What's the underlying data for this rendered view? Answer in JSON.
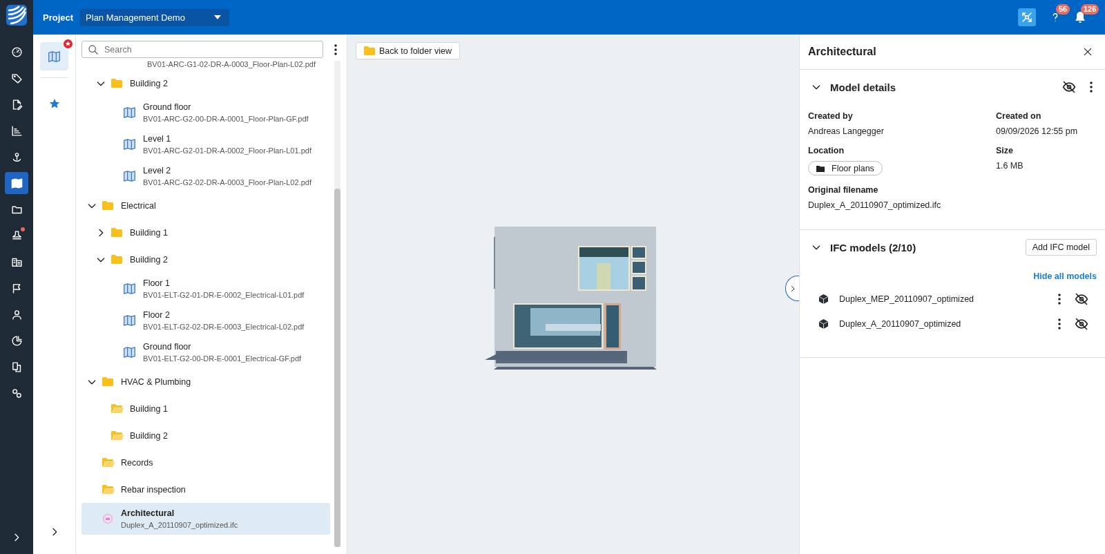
{
  "top_bar": {
    "project_label": "Project",
    "project_select": "Plan Management Demo",
    "help_badge": "56",
    "notifications_badge": "126"
  },
  "nav_rail": {
    "items": [
      {
        "selected": false,
        "dot": false
      },
      {
        "selected": false,
        "dot": false
      },
      {
        "selected": false,
        "dot": false
      },
      {
        "selected": false,
        "dot": false
      },
      {
        "selected": false,
        "dot": false
      },
      {
        "selected": true,
        "dot": false
      },
      {
        "selected": false,
        "dot": false
      },
      {
        "selected": false,
        "dot": true
      },
      {
        "selected": false,
        "dot": false
      },
      {
        "selected": false,
        "dot": false
      },
      {
        "selected": false,
        "dot": false
      },
      {
        "selected": false,
        "dot": false
      },
      {
        "selected": false,
        "dot": false
      },
      {
        "selected": false,
        "dot": false
      }
    ]
  },
  "side_rail": {
    "items": [
      {
        "selected": true,
        "badge": true
      },
      {
        "selected": false,
        "badge": false
      }
    ]
  },
  "tree": {
    "search": {
      "placeholder": "Search"
    },
    "cut_filename": "BV01-ARC-G1-02-DR-A-0003_Floor-Plan-L02.pdf",
    "continued": [
      {
        "kind": "folder",
        "label": "Building 2",
        "expanded": true,
        "selected": false,
        "children": [
          {
            "kind": "plan",
            "label": "Ground floor",
            "filename": "BV01-ARC-G2-00-DR-A-0001_Floor-Plan-GF.pdf",
            "selected": false
          },
          {
            "kind": "plan",
            "label": "Level 1",
            "filename": "BV01-ARC-G2-01-DR-A-0002_Floor-Plan-L01.pdf",
            "selected": false
          },
          {
            "kind": "plan",
            "label": "Level 2",
            "filename": "BV01-ARC-G2-02-DR-A-0003_Floor-Plan-L02.pdf",
            "selected": false
          }
        ]
      }
    ],
    "items": [
      {
        "kind": "folder",
        "label": "Electrical",
        "expanded": true,
        "selected": false,
        "children": [
          {
            "kind": "folder",
            "label": "Building 1",
            "expanded": false,
            "selected": false
          },
          {
            "kind": "folder",
            "label": "Building 2",
            "expanded": true,
            "selected": false,
            "children": [
              {
                "kind": "plan",
                "label": "Floor 1",
                "filename": "BV01-ELT-G2-01-DR-E-0002_Electrical-L01.pdf",
                "selected": false
              },
              {
                "kind": "plan",
                "label": "Floor 2",
                "filename": "BV01-ELT-G2-02-DR-E-0003_Electrical-L02.pdf",
                "selected": false
              },
              {
                "kind": "plan",
                "label": "Ground floor",
                "filename": "BV01-ELT-G2-00-DR-E-0001_Electrical-GF.pdf",
                "selected": false
              }
            ]
          }
        ]
      },
      {
        "kind": "folder",
        "label": "HVAC & Plumbing",
        "expanded": true,
        "selected": false,
        "children": [
          {
            "kind": "empty_folder",
            "label": "Building 1",
            "selected": false
          },
          {
            "kind": "empty_folder",
            "label": "Building 2",
            "selected": false
          }
        ]
      },
      {
        "kind": "empty_folder",
        "label": "Records",
        "selected": false
      },
      {
        "kind": "empty_folder",
        "label": "Rebar inspection",
        "selected": false
      },
      {
        "kind": "model",
        "label": "Architectural",
        "filename": "Duplex_A_20110907_optimized.ifc",
        "selected": true
      }
    ]
  },
  "viewer": {
    "back_button": "Back to folder view"
  },
  "details": {
    "title": "Architectural",
    "model_details": {
      "heading": "Model details",
      "expanded": true,
      "visible": false,
      "fields": [
        {
          "kind": "text",
          "label": "Created by",
          "value": "Andreas Langegger"
        },
        {
          "kind": "text",
          "label": "Created on",
          "value": "09/09/2026 12:55 pm"
        },
        {
          "kind": "chip",
          "label": "Location",
          "value": "Floor plans"
        },
        {
          "kind": "text",
          "label": "Size",
          "value": "1.6 MB"
        },
        {
          "kind": "wide",
          "label": "Original filename",
          "value": "Duplex_A_20110907_optimized.ifc"
        }
      ]
    },
    "ifc_models": {
      "heading": "IFC models (2/10)",
      "expanded": true,
      "add_button": "Add IFC model",
      "hide_all_link": "Hide all models",
      "models": [
        {
          "name": "Duplex_MEP_20110907_optimized",
          "visible": false
        },
        {
          "name": "Duplex_A_20110907_optimized",
          "visible": false
        }
      ]
    }
  }
}
